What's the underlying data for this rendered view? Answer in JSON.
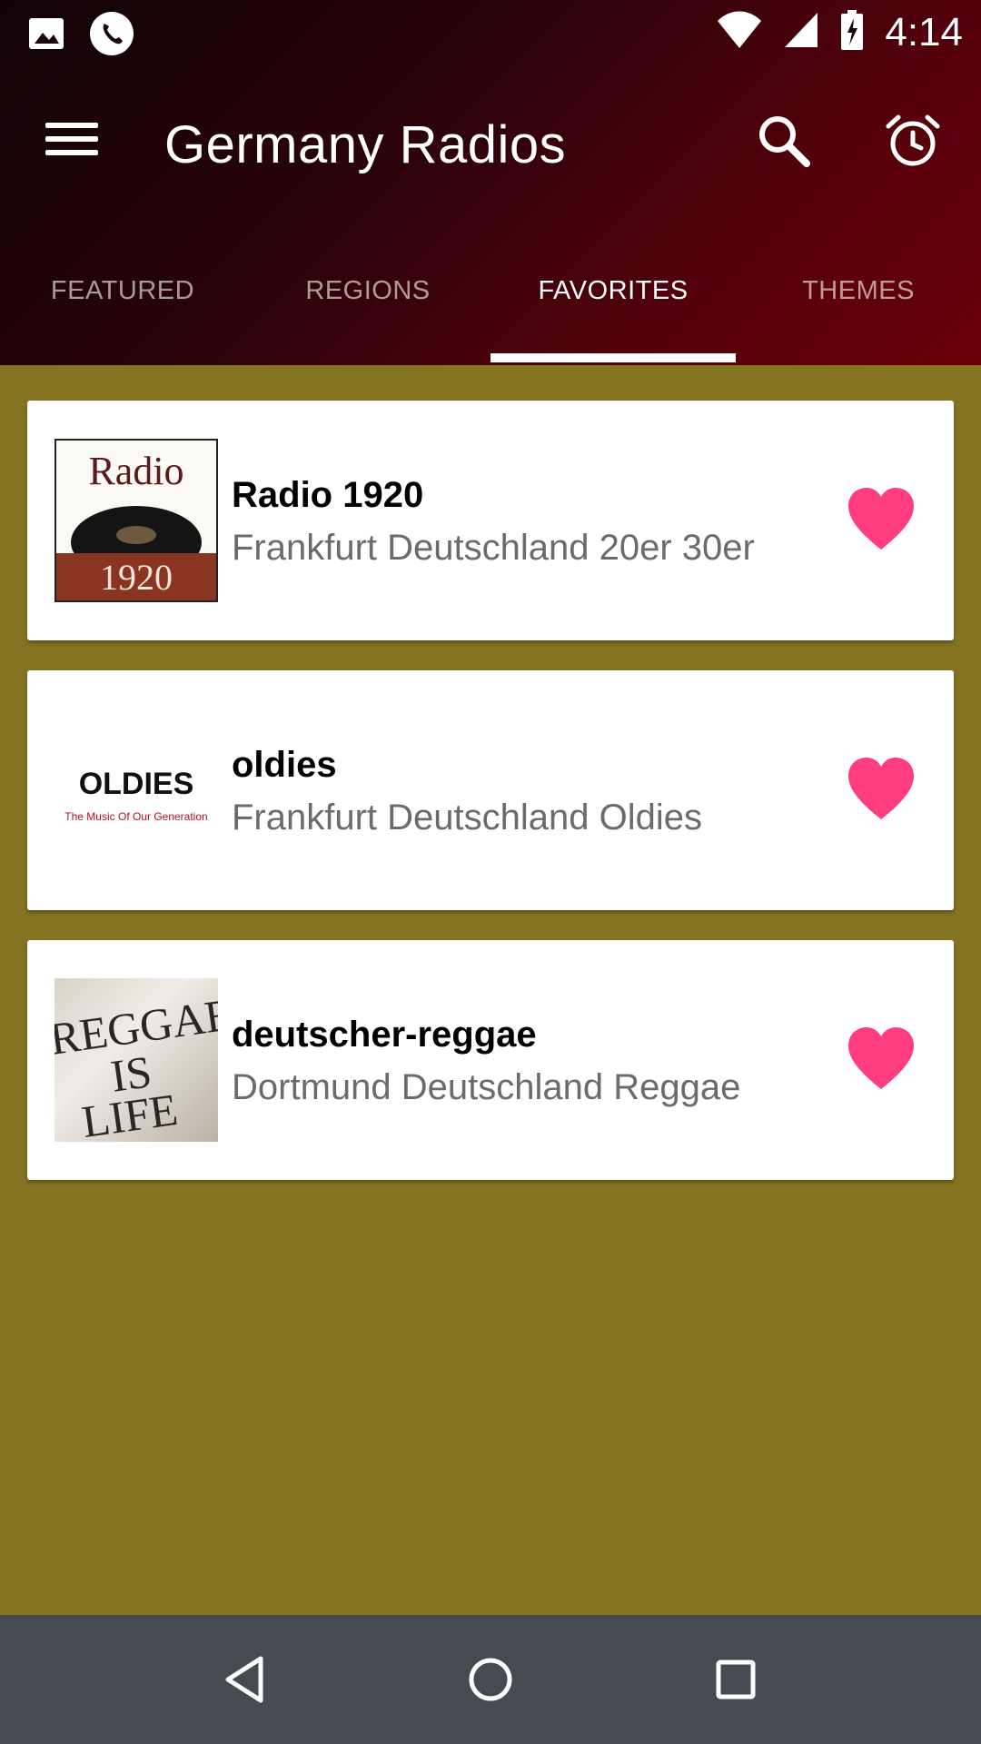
{
  "status": {
    "time": "4:14"
  },
  "app": {
    "title": "Germany Radios"
  },
  "tabs": [
    {
      "label": "FEATURED",
      "active": false
    },
    {
      "label": "REGIONS",
      "active": false
    },
    {
      "label": "FAVORITES",
      "active": true
    },
    {
      "label": "THEMES",
      "active": false
    }
  ],
  "stations": [
    {
      "name": "Radio 1920",
      "subtitle": "Frankfurt Deutschland 20er 30er",
      "logo_text_top": "Radio",
      "logo_text_bottom": "1920",
      "favorite": true
    },
    {
      "name": "oldies",
      "subtitle": "Frankfurt Deutschland Oldies",
      "logo_text_top": "OLDIES",
      "logo_text_bottom": "The Music Of Our Generation",
      "favorite": true
    },
    {
      "name": "deutscher-reggae",
      "subtitle": "Dortmund Deutschland Reggae",
      "logo_text_top": "REGGAE",
      "logo_text_middle": "IS",
      "logo_text_bottom": "LIFE",
      "favorite": true
    }
  ],
  "colors": {
    "background": "#847421",
    "heart": "#ff3d7f",
    "navbar": "#454b50",
    "header_dark": "#100306",
    "header_red": "#6a0008"
  },
  "icons": {
    "status_left": [
      "image-icon",
      "phone-icon"
    ],
    "status_right": [
      "wifi-icon",
      "signal-icon",
      "battery-charging-icon"
    ],
    "appbar": [
      "menu-icon",
      "search-icon",
      "alarm-clock-icon"
    ],
    "navbar": [
      "back-icon",
      "home-icon",
      "recents-icon"
    ]
  }
}
